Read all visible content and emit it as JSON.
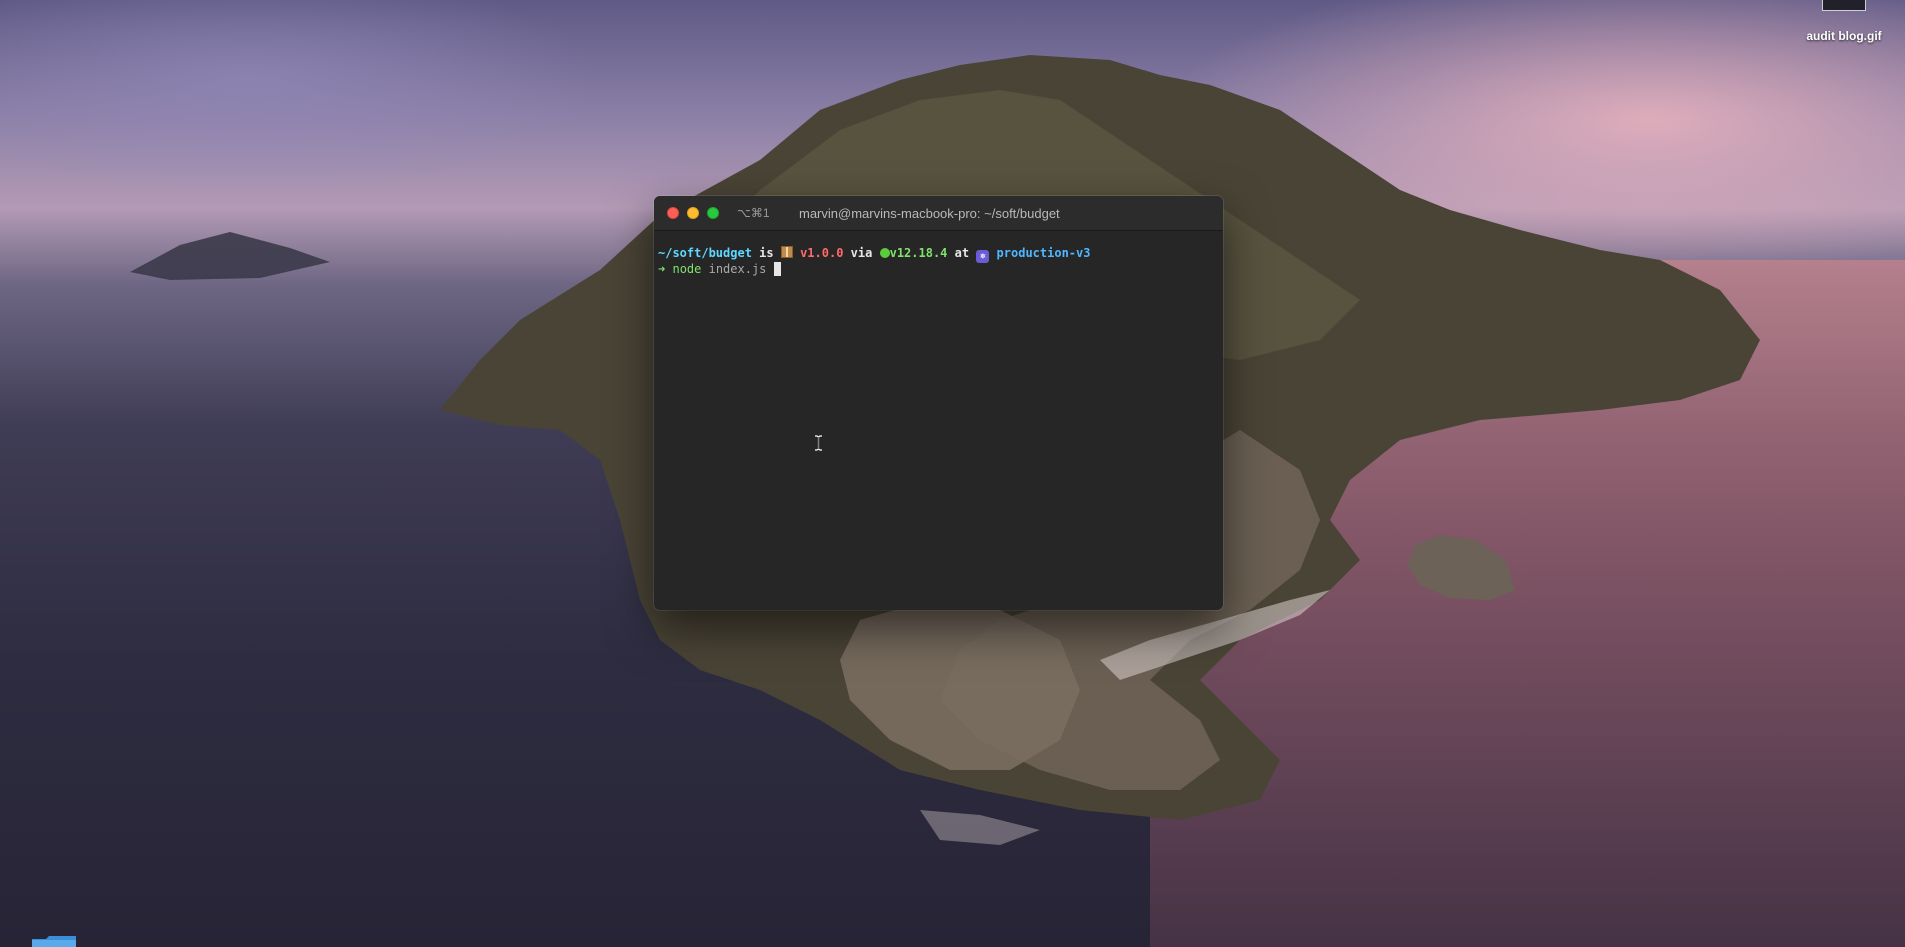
{
  "desktop": {
    "file_icon": {
      "label": "audit blog.gif"
    }
  },
  "terminal": {
    "tab_shortcut": "⌥⌘1",
    "title": "marvin@marvins-macbook-pro: ~/soft/budget",
    "prompt": {
      "path": "~/soft/budget",
      "is_word": "is",
      "package_icon": "package-icon",
      "package_version": "v1.0.0",
      "via_word": "via",
      "node_icon": "nodejs-icon",
      "node_version": "v12.18.4",
      "at_word": "at",
      "context_icon": "helm-icon",
      "context": "production-v3"
    },
    "command": {
      "arrow": "➜",
      "program": "node",
      "argument": "index.js"
    }
  }
}
